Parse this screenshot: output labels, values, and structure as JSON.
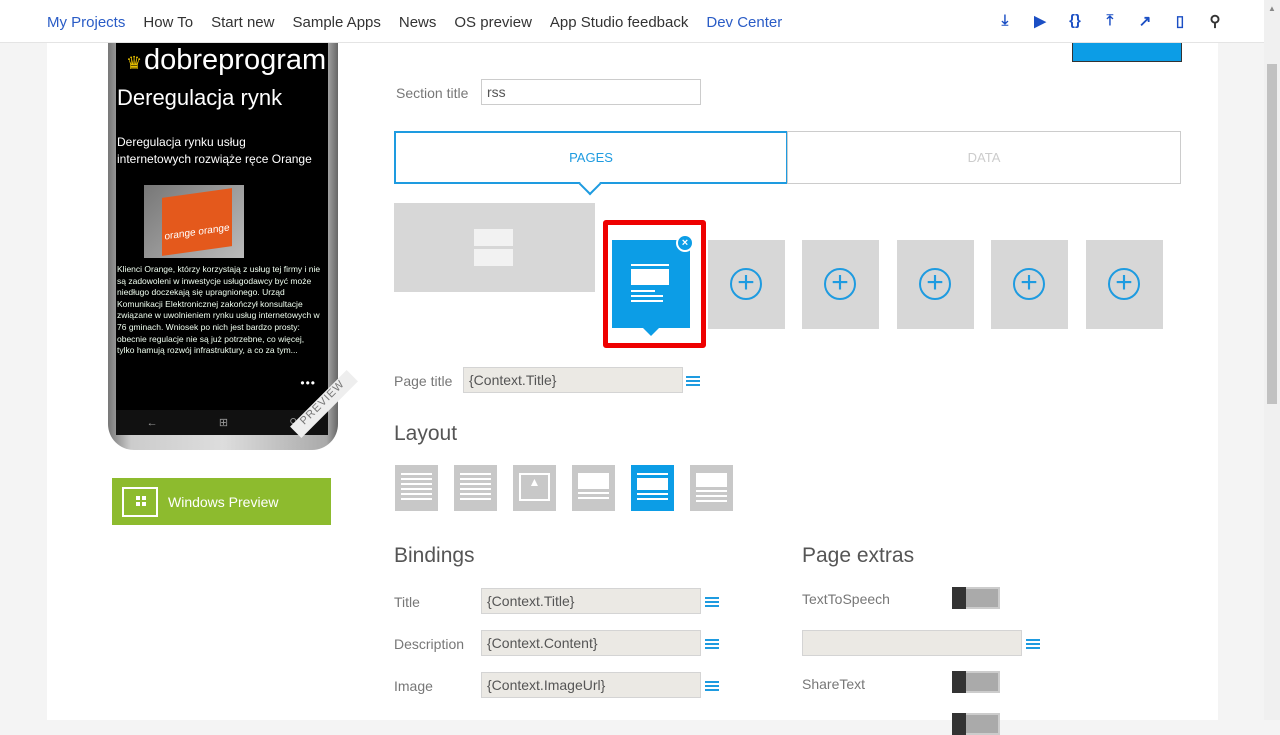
{
  "nav": {
    "items": [
      "My Projects",
      "How To",
      "Start new",
      "Sample Apps",
      "News",
      "OS preview",
      "App Studio feedback",
      "Dev Center"
    ]
  },
  "toolbar": {
    "icons": [
      "download-icon",
      "play-icon",
      "code-braces-icon",
      "publish-icon",
      "chart-icon",
      "phone-icon",
      "search-icon"
    ],
    "glyphs": [
      "⤓",
      "▶",
      "{}",
      "⤒",
      "↗",
      "▯",
      "⚲"
    ]
  },
  "phone": {
    "app_name": "dobreprogram",
    "page_title": "Deregulacja rynk",
    "headline": "Deregulacja rynku usług internetowych rozwiąże ręce Orange",
    "image_text": "orange orange",
    "body": "Klienci Orange, którzy korzystają z usług tej firmy i nie są zadowoleni w inwestycje usługodawcy być może niedługo doczekają się upragnionego. Urząd Komunikacji Elektronicznej zakończył konsultacje związane w uwolnieniem rynku usług internetowych w 76 gminach. Wniosek po nich jest bardzo prosty: obecnie regulacje nie są już potrzebne, co więcej, tylko hamują rozwój infrastruktury, a co za tym...",
    "more": "•••",
    "badge": "PREVIEW"
  },
  "windows_preview": "Windows Preview",
  "section": {
    "label": "Section title",
    "value": "rss"
  },
  "tabs": [
    {
      "label": "PAGES",
      "active": true
    },
    {
      "label": "DATA",
      "active": false
    }
  ],
  "page_title": {
    "label": "Page title",
    "value": "{Context.Title}"
  },
  "layout": {
    "title": "Layout",
    "selected_index": 4
  },
  "bindings": {
    "title": "Bindings",
    "rows": [
      {
        "label": "Title",
        "value": "{Context.Title}"
      },
      {
        "label": "Description",
        "value": "{Context.Content}"
      },
      {
        "label": "Image",
        "value": "{Context.ImageUrl}"
      }
    ]
  },
  "extras": {
    "title": "Page extras",
    "text_to_speech": "TextToSpeech",
    "tts_value": "",
    "share_text": "ShareText"
  },
  "colors": {
    "accent": "#0c9de6",
    "highlight": "#e00000",
    "green": "#8dbb2e"
  }
}
